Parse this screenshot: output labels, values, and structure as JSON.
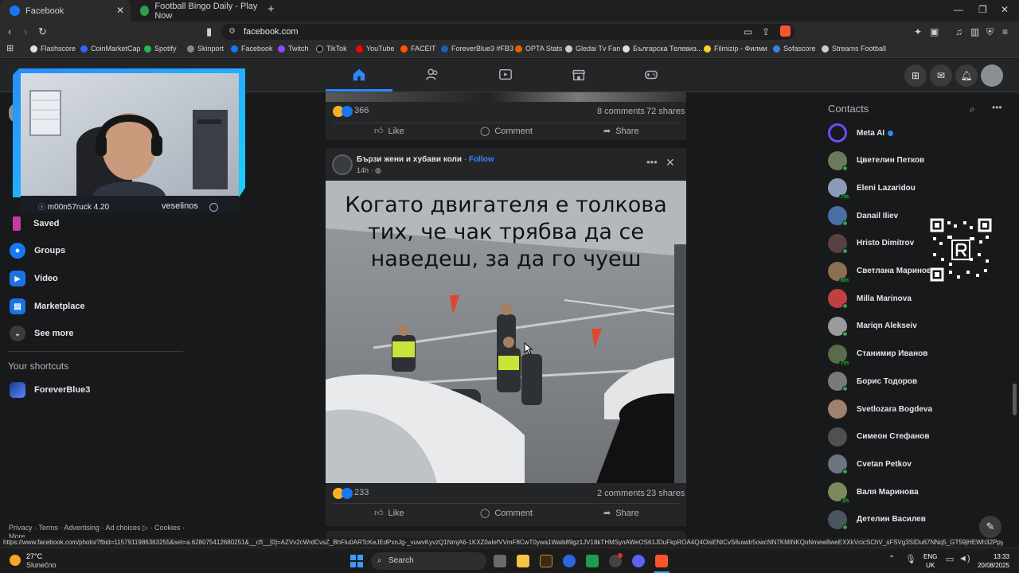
{
  "browser": {
    "tabs": [
      {
        "title": "Facebook",
        "active": true
      },
      {
        "title": "Football Bingo Daily - Play Now",
        "active": false
      }
    ],
    "url": "facebook.com",
    "bookmarks": [
      "Flashscore",
      "CoinMarketCap",
      "Spotify",
      "Skinport",
      "Facebook",
      "Twitch",
      "TikTok",
      "YouTube",
      "FACEIT",
      "ForeverBlue3 #FB3",
      "OPTA Stats",
      "Gledai Tv Fan",
      "Българска Телевиз...",
      "Filmizip - Филми",
      "Sofascore",
      "Streams Football"
    ],
    "status_url": "https://www.facebook.com/photo/?fbid=1157911986363255&set=a.628075412680251&__cft__[0]=AZVv2cWrdCvsZ_BhFlu0ARTcKeJEdPxnJg-_vuwvKyvzQ1NmjA6-1KXZ0aIefVVmF8CwT0ywa1Waib89gz1JV18kTHMSynAWeOS61JDuFkpROA4Q4OisENICvS6uwdr5owcNN7KMiNKQoNmew8weEXXkVcicSChV_sFSVg3SIDu67NNq5_GT59jHEWh32Ppyt3Y5ebdm..."
  },
  "webcam": {
    "left_name": "m00n57ruck 4.20",
    "right_name": "veselinos"
  },
  "left_sidebar": {
    "items": [
      {
        "label": "Saved",
        "icon": "bookmark-icon",
        "color": "#c63aa4"
      },
      {
        "label": "Groups",
        "icon": "groups-icon",
        "color": "#1877f2"
      },
      {
        "label": "Video",
        "icon": "video-icon",
        "color": "#1b74e4"
      },
      {
        "label": "Marketplace",
        "icon": "marketplace-icon",
        "color": "#1b74e4"
      },
      {
        "label": "See more",
        "icon": "chevron-down-icon",
        "color": "#3a3b3c"
      }
    ],
    "shortcuts_title": "Your shortcuts",
    "shortcuts": [
      {
        "label": "ForeverBlue3"
      }
    ],
    "footer": {
      "links": [
        "Privacy",
        "·",
        "Terms",
        "·",
        "Advertising",
        "·",
        "Ad choices",
        "·",
        "Cookies",
        "·"
      ],
      "more": "More"
    }
  },
  "feed": {
    "post1": {
      "reactions": "366",
      "comments": "8 comments",
      "shares": "72 shares",
      "like": "Like",
      "comment": "Comment",
      "share": "Share"
    },
    "post2": {
      "page_name": "Бързи жени и хубави коли",
      "follow": "Follow",
      "time": "14h",
      "image_caption": "Когато двигателя е толкова тих, че чак трябва да се наведеш, за да го чуеш",
      "reactions": "233",
      "comments": "2 comments",
      "shares": "23 shares",
      "like": "Like",
      "comment": "Comment",
      "share": "Share"
    }
  },
  "contacts": {
    "title": "Contacts",
    "list": [
      {
        "name": "Meta AI",
        "online": false,
        "color": "#6b4cff"
      },
      {
        "name": "Цветелин Петков",
        "online": true,
        "color": "#6a7a5a"
      },
      {
        "name": "Eleni Lazaridou",
        "online": false,
        "color": "#8a9bb5",
        "badge": "7m"
      },
      {
        "name": "Danail Iliev",
        "online": true,
        "color": "#4a6fa5"
      },
      {
        "name": "Hristo Dimitrov",
        "online": true,
        "color": "#5a4040"
      },
      {
        "name": "Светлана Маринова",
        "online": false,
        "color": "#8a7050",
        "badge": "6m"
      },
      {
        "name": "Milla Marinova",
        "online": true,
        "color": "#c04040"
      },
      {
        "name": "Mariqn Alekseiv",
        "online": true,
        "color": "#9a9a9a"
      },
      {
        "name": "Станимир Иванов",
        "online": false,
        "color": "#5a6a4a",
        "badge": "7m"
      },
      {
        "name": "Борис Тодоров",
        "online": true,
        "color": "#7a7a7a"
      },
      {
        "name": "Svetlozara Bogdeva",
        "online": false,
        "color": "#a08070"
      },
      {
        "name": "Симеон Стефанов",
        "online": false,
        "color": "#505050"
      },
      {
        "name": "Cvetan Petkov",
        "online": true,
        "color": "#6a7580"
      },
      {
        "name": "Валя Маринова",
        "online": false,
        "color": "#7a8a5a",
        "badge": "1h"
      },
      {
        "name": "Детелин Василев",
        "online": true,
        "color": "#4a5560"
      }
    ]
  },
  "taskbar": {
    "weather_temp": "27°C",
    "weather_desc": "Slunečno",
    "search": "Search",
    "lang1": "ENG",
    "lang2": "UK",
    "time": "13:33",
    "date": "20/08/2025"
  }
}
